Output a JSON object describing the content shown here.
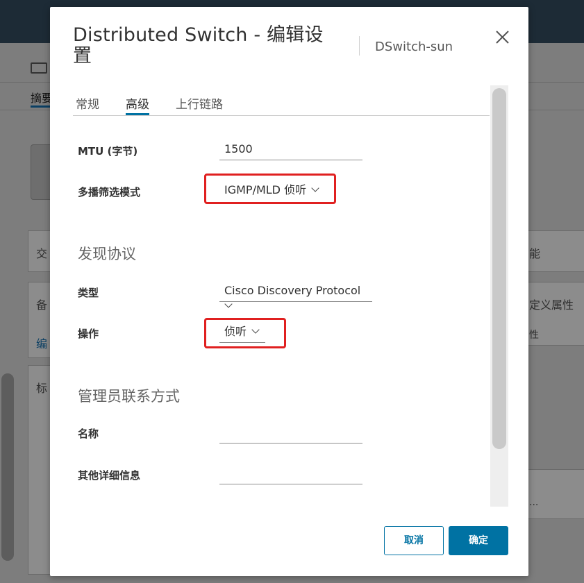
{
  "background": {
    "tab_label": "摘要",
    "panel_labels": [
      "交",
      "备",
      "编",
      "标"
    ],
    "right_labels": [
      "能",
      "定义属性",
      "性",
      "..."
    ]
  },
  "modal": {
    "title": "Distributed Switch - 编辑设置",
    "subtitle": "DSwitch-sun",
    "tabs": [
      {
        "label": "常规"
      },
      {
        "label": "高级"
      },
      {
        "label": "上行链路"
      }
    ],
    "active_tab": "高级",
    "fields": {
      "mtu": {
        "label": "MTU (字节)",
        "value": "1500"
      },
      "multicast": {
        "label": "多播筛选模式",
        "value": "IGMP/MLD 侦听"
      },
      "discovery_heading": "发现协议",
      "type": {
        "label": "类型",
        "value": "Cisco Discovery Protocol"
      },
      "operation": {
        "label": "操作",
        "value": "侦听"
      },
      "admin_heading": "管理员联系方式",
      "name": {
        "label": "名称",
        "value": ""
      },
      "other_info": {
        "label": "其他详细信息",
        "value": ""
      }
    },
    "buttons": {
      "cancel": "取消",
      "ok": "确定"
    }
  },
  "colors": {
    "accent": "#0072a3",
    "highlight": "#e02020",
    "topbar": "#1d2b36"
  },
  "icons": [
    "close-icon",
    "chevron-down-icon",
    "switch-icon"
  ]
}
